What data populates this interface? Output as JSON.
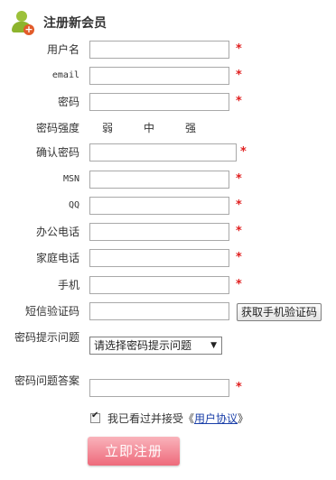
{
  "header": {
    "title": "注册新会员"
  },
  "fields": {
    "username": {
      "label": "用户名"
    },
    "email": {
      "label": "email"
    },
    "password": {
      "label": "密码"
    },
    "strength": {
      "label": "密码强度",
      "weak": "弱",
      "medium": "中",
      "strong": "强"
    },
    "confirm": {
      "label": "确认密码"
    },
    "msn": {
      "label": "MSN"
    },
    "qq": {
      "label": "QQ"
    },
    "office_phone": {
      "label": "办公电话"
    },
    "home_phone": {
      "label": "家庭电话"
    },
    "mobile": {
      "label": "手机"
    },
    "sms_code": {
      "label": "短信验证码",
      "button": "获取手机验证码"
    },
    "question": {
      "label": "密码提示问题",
      "selected": "请选择密码提示问题"
    },
    "answer": {
      "label": "密码问题答案"
    }
  },
  "required_mark": "*",
  "agreement": {
    "text": "我已看过并接受《",
    "link": "用户协议",
    "close": "》"
  },
  "submit_label": "立即注册"
}
